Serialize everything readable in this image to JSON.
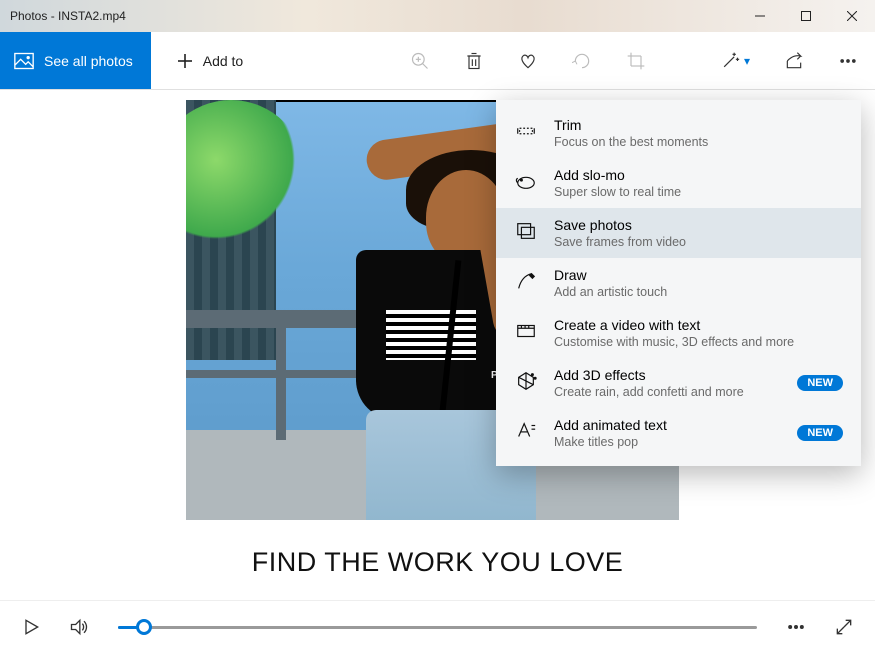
{
  "window": {
    "title": "Photos - INSTA2.mp4"
  },
  "toolbar": {
    "see_all_label": "See all photos",
    "add_to_label": "Add to"
  },
  "caption": "FIND THE WORK YOU LOVE",
  "shirt_brand": "Polaroid",
  "dropdown": {
    "items": [
      {
        "title": "Trim",
        "sub": "Focus on the best moments",
        "icon": "trim-icon",
        "selected": false,
        "badge": ""
      },
      {
        "title": "Add slo-mo",
        "sub": "Super slow to real time",
        "icon": "slomo-icon",
        "selected": false,
        "badge": ""
      },
      {
        "title": "Save photos",
        "sub": "Save frames from video",
        "icon": "saveframes-icon",
        "selected": true,
        "badge": ""
      },
      {
        "title": "Draw",
        "sub": "Add an artistic touch",
        "icon": "draw-icon",
        "selected": false,
        "badge": ""
      },
      {
        "title": "Create a video with text",
        "sub": "Customise with music, 3D effects and more",
        "icon": "createvideo-icon",
        "selected": false,
        "badge": ""
      },
      {
        "title": "Add 3D effects",
        "sub": "Create rain, add confetti and more",
        "icon": "3deffects-icon",
        "selected": false,
        "badge": "NEW"
      },
      {
        "title": "Add animated text",
        "sub": "Make titles pop",
        "icon": "animtext-icon",
        "selected": false,
        "badge": "NEW"
      }
    ]
  },
  "playback": {
    "progress_percent": 4
  },
  "colors": {
    "accent": "#0078d7"
  }
}
